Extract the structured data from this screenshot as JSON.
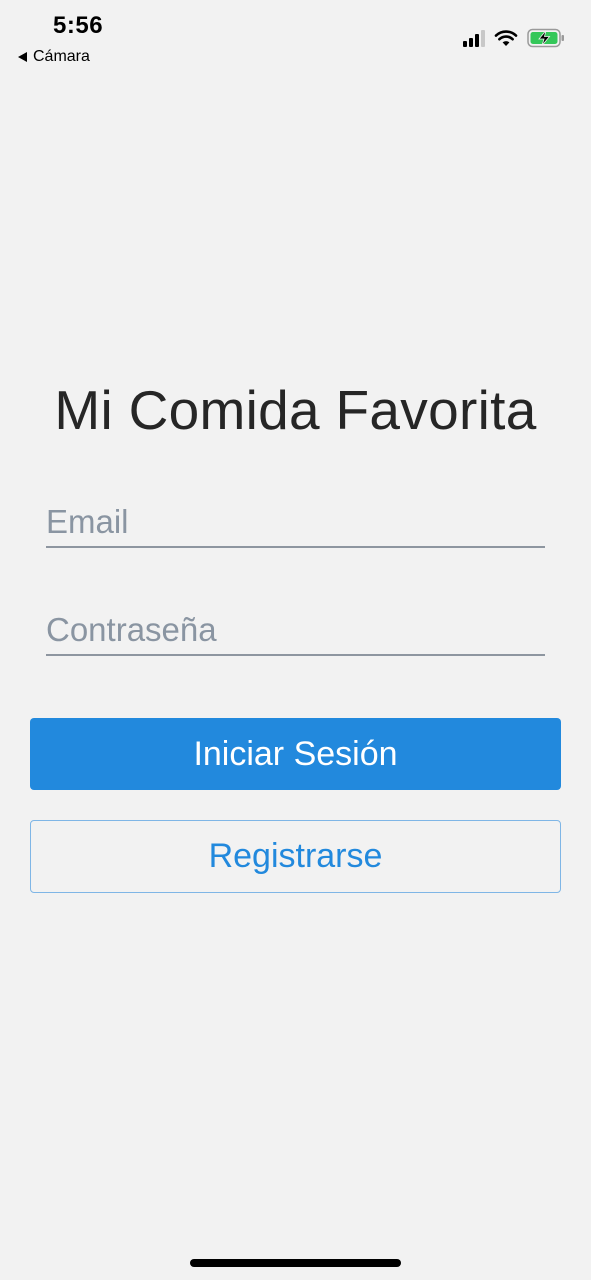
{
  "status_bar": {
    "time": "5:56",
    "back_app": "Cámara",
    "icons": [
      "signal-icon",
      "wifi-icon",
      "battery-charging-icon"
    ],
    "battery_color": "#34c759"
  },
  "login": {
    "title": "Mi Comida Favorita",
    "email_placeholder": "Email",
    "email_value": "",
    "password_placeholder": "Contraseña",
    "password_value": "",
    "login_button": "Iniciar Sesión",
    "register_button": "Registrarse"
  },
  "colors": {
    "accent": "#2289dd",
    "background": "#f2f2f2",
    "placeholder": "#8a95a2"
  }
}
